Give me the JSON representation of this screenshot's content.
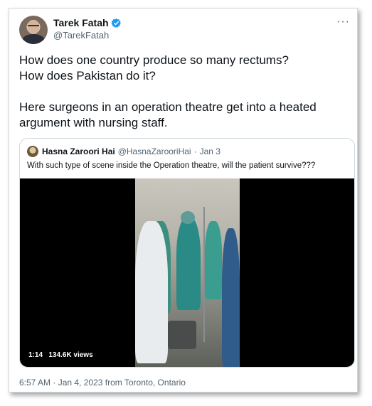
{
  "tweet": {
    "author_name": "Tarek Fatah",
    "author_handle": "@TarekFatah",
    "more_icon": "···",
    "text_lines": [
      "How does one country produce so many rectums?",
      "How does Pakistan do it?",
      "Here surgeons in an operation theatre get into a heated",
      "argument with nursing staff."
    ],
    "footer": "6:57 AM · Jan 4, 2023 from Toronto, Ontario",
    "verified_color": "#1d9bf0"
  },
  "quoted": {
    "author_name": "Hasna Zaroori Hai",
    "author_handle": "@HasnaZarooriHai",
    "dot": "·",
    "date": "Jan 3",
    "text": "With such type of scene inside the Operation theatre, will the patient survive???",
    "video_duration": "1:14",
    "video_views": "134.6K views"
  }
}
